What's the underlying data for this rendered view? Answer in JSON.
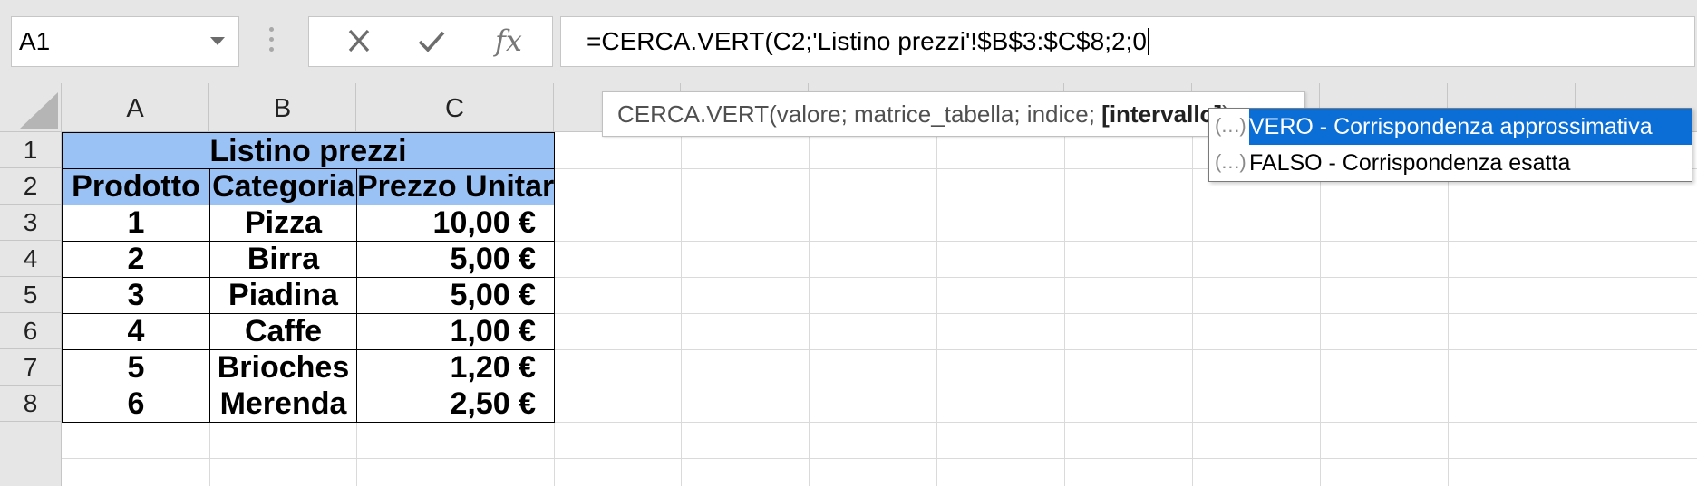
{
  "name_box": {
    "value": "A1"
  },
  "formula_bar": {
    "fx_label": "fx",
    "formula": "=CERCA.VERT(C2;'Listino prezzi'!$B$3:$C$8;2;0"
  },
  "columns": [
    "A",
    "B",
    "C",
    "",
    "",
    "",
    "",
    "",
    "",
    "",
    ""
  ],
  "rows": [
    "1",
    "2",
    "3",
    "4",
    "5",
    "6",
    "7",
    "8"
  ],
  "table": {
    "title": "Listino prezzi",
    "headers": [
      "Prodotto",
      "Categoria",
      "Prezzo Unitario"
    ],
    "rows": [
      [
        "1",
        "Pizza",
        "10,00 €"
      ],
      [
        "2",
        "Birra",
        "5,00 €"
      ],
      [
        "3",
        "Piadina",
        "5,00 €"
      ],
      [
        "4",
        "Caffe",
        "1,00 €"
      ],
      [
        "5",
        "Brioches",
        "1,20 €"
      ],
      [
        "6",
        "Merenda",
        "2,50 €"
      ]
    ]
  },
  "tooltip": {
    "signature": "CERCA.VERT(valore; matrice_tabella; indice; ",
    "current_arg": "[intervallo]",
    "close": ")"
  },
  "autocomplete": {
    "icon": "(…)",
    "items": [
      {
        "label": "VERO - Corrispondenza approssimativa",
        "selected": true
      },
      {
        "label": "FALSO - Corrispondenza esatta",
        "selected": false
      }
    ]
  },
  "colors": {
    "header_fill": "#9bc2f5",
    "selection": "#0a6ed6"
  }
}
